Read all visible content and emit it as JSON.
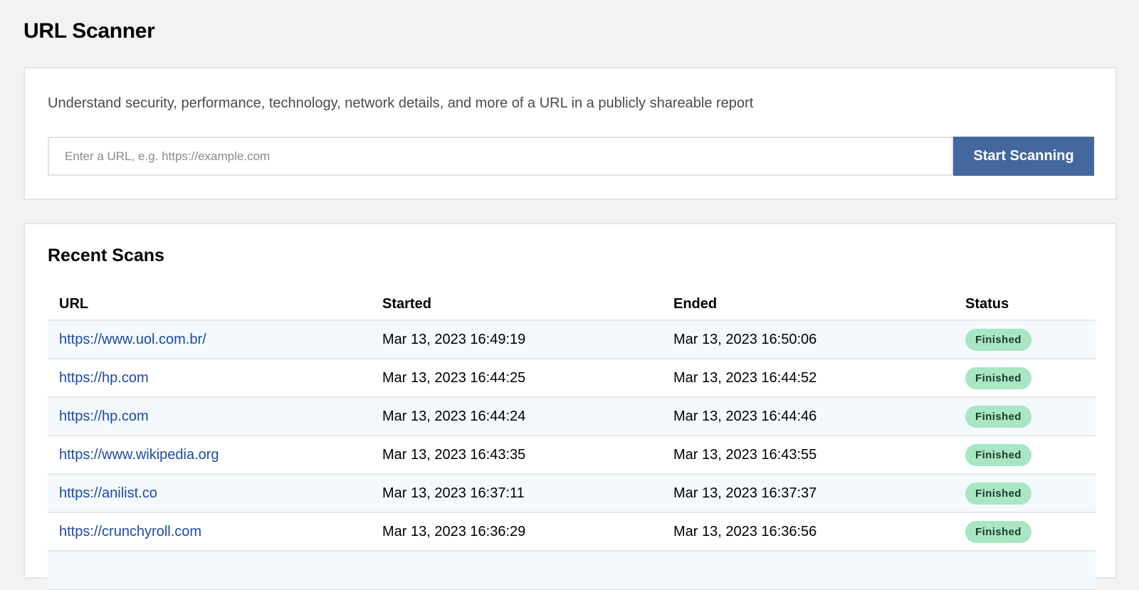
{
  "page": {
    "title": "URL Scanner"
  },
  "scanner": {
    "description": "Understand security, performance, technology, network details, and more of a URL in a publicly shareable report",
    "input_value": "",
    "input_placeholder": "Enter a URL, e.g. https://example.com",
    "button_label": "Start Scanning"
  },
  "recent": {
    "title": "Recent Scans",
    "columns": [
      "URL",
      "Started",
      "Ended",
      "Status"
    ],
    "rows": [
      {
        "url": "https://www.uol.com.br/",
        "started": "Mar 13, 2023 16:49:19",
        "ended": "Mar 13, 2023 16:50:06",
        "status": "Finished"
      },
      {
        "url": "https://hp.com",
        "started": "Mar 13, 2023 16:44:25",
        "ended": "Mar 13, 2023 16:44:52",
        "status": "Finished"
      },
      {
        "url": "https://hp.com",
        "started": "Mar 13, 2023 16:44:24",
        "ended": "Mar 13, 2023 16:44:46",
        "status": "Finished"
      },
      {
        "url": "https://www.wikipedia.org",
        "started": "Mar 13, 2023 16:43:35",
        "ended": "Mar 13, 2023 16:43:55",
        "status": "Finished"
      },
      {
        "url": "https://anilist.co",
        "started": "Mar 13, 2023 16:37:11",
        "ended": "Mar 13, 2023 16:37:37",
        "status": "Finished"
      },
      {
        "url": "https://crunchyroll.com",
        "started": "Mar 13, 2023 16:36:29",
        "ended": "Mar 13, 2023 16:36:56",
        "status": "Finished"
      },
      {
        "url": "",
        "started": "",
        "ended": "",
        "status": ""
      }
    ]
  },
  "colors": {
    "accent": "#44679f",
    "link": "#1d4aa6",
    "status_finished_bg": "#a8e6c4",
    "row_alt_bg": "#f3f9fc"
  }
}
